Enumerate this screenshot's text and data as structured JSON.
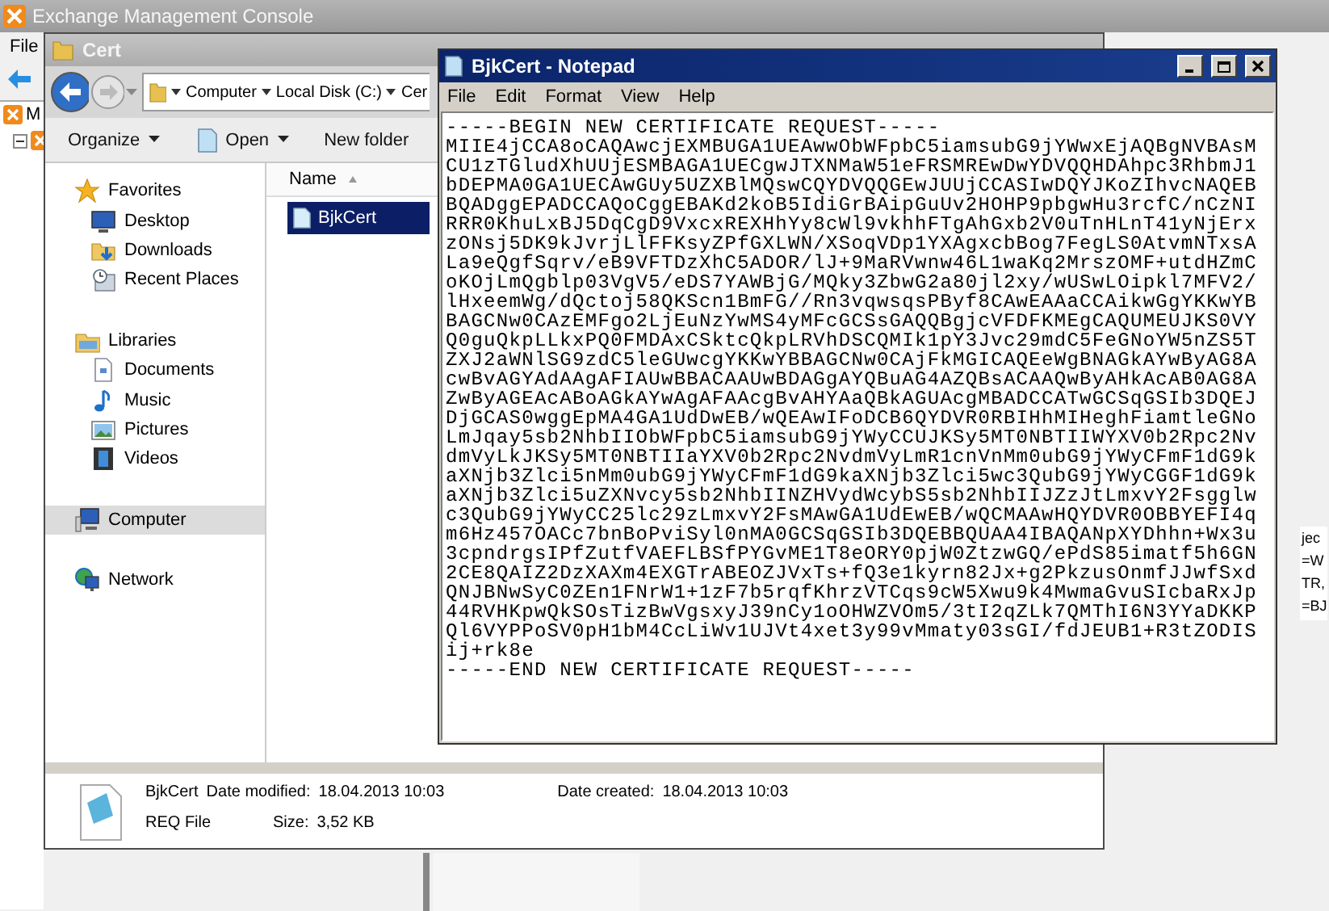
{
  "emc": {
    "title": "Exchange Management Console",
    "menu": [
      "File"
    ],
    "tree": [
      {
        "label": "M",
        "expanded": false
      },
      {
        "expanded": true
      }
    ],
    "fragments": [
      "jec",
      "=W",
      "TR,",
      "=BJ"
    ]
  },
  "explorer": {
    "title": "Cert",
    "breadcrumb": [
      "Computer",
      "Local Disk (C:)",
      "Cer"
    ],
    "toolbar": [
      {
        "label": "Organize",
        "kind": "menu"
      },
      {
        "label": "Open",
        "kind": "open"
      },
      {
        "label": "New folder",
        "kind": "plain"
      }
    ],
    "nav": [
      {
        "label": "Favorites",
        "kind": "star",
        "selected": false,
        "children": [
          {
            "label": "Desktop",
            "kind": "desktop",
            "selected": false
          },
          {
            "label": "Downloads",
            "kind": "downloads",
            "selected": false
          },
          {
            "label": "Recent Places",
            "kind": "recent",
            "selected": false
          }
        ]
      },
      {
        "label": "Libraries",
        "kind": "library",
        "selected": false,
        "children": [
          {
            "label": "Documents",
            "kind": "document",
            "selected": false
          },
          {
            "label": "Music",
            "kind": "music",
            "selected": false
          },
          {
            "label": "Pictures",
            "kind": "picture",
            "selected": false
          },
          {
            "label": "Videos",
            "kind": "video",
            "selected": false
          }
        ]
      },
      {
        "label": "Computer",
        "kind": "computer",
        "selected": true
      },
      {
        "label": "Network",
        "kind": "network",
        "selected": false
      }
    ],
    "columns": [
      "Name"
    ],
    "files": [
      {
        "name": "BjkCert",
        "selected": true
      }
    ],
    "details": {
      "name": "BjkCert",
      "type": "REQ File",
      "modified_label": "Date modified:",
      "modified": "18.04.2013 10:03",
      "size_label": "Size:",
      "size": "3,52 KB",
      "created_label": "Date created:",
      "created": "18.04.2013 10:03"
    }
  },
  "notepad": {
    "title": "BjkCert - Notepad",
    "menu": [
      "File",
      "Edit",
      "Format",
      "View",
      "Help"
    ],
    "lines": [
      "-----BEGIN NEW CERTIFICATE REQUEST-----",
      "MIIE4jCCA8oCAQAwcjEXMBUGA1UEAwwObWFpbC5iamsubG9jYWwxEjAQBgNVBAsM",
      "CU1zTGludXhUUjESMBAGA1UECgwJTXNMaW51eFRSMREwDwYDVQQHDAhpc3RhbmJ1",
      "bDEPMA0GA1UECAwGUy5UZXBlMQswCQYDVQQGEwJUUjCCASIwDQYJKoZIhvcNAQEB",
      "BQADggEPADCCAQoCggEBAKd2koB5IdiGrBAipGuUv2HOHP9pbgwHu3rcfC/nCzNI",
      "RRR0KhuLxBJ5DqCgD9VxcxREXHhYy8cWl9vkhhFTgAhGxb2V0uTnHLnT41yNjErx",
      "zONsj5DK9kJvrjLlFFKsyZPfGXLWN/XSoqVDp1YXAgxcbBog7FegLS0AtvmNTxsA",
      "La9eQgfSqrv/eB9VFTDzXhC5ADOR/lJ+9MaRVwnw46L1waKq2MrszOMF+utdHZmC",
      "oKOjLmQgblp03VgV5/eDS7YAWBjG/MQky3ZbwG2a80jl2xy/wUSwLOipkl7MFV2/",
      "lHxeemWg/dQctoj58QKScn1BmFG//Rn3vqwsqsPByf8CAwEAAaCCAikwGgYKKwYB",
      "BAGCNw0CAzEMFgo2LjEuNzYwMS4yMFcGCSsGAQQBgjcVFDFKMEgCAQUMEUJKS0VY",
      "Q0guQkpLLkxPQ0FMDAxCSktcQkpLRVhDSCQMIk1pY3Jvc29mdC5FeGNoYW5nZS5T",
      "ZXJ2aWNlSG9zdC5leGUwcgYKKwYBBAGCNw0CAjFkMGICAQEeWgBNAGkAYwByAG8A",
      "cwBvAGYAdAAgAFIAUwBBACAAUwBDAGgAYQBuAG4AZQBsACAAQwByAHkAcAB0AG8A",
      "ZwByAGEAcABoAGkAYwAgAFAAcgBvAHYAaQBkAGUAcgMBADCCATwGCSqGSIb3DQEJ",
      "DjGCAS0wggEpMA4GA1UdDwEB/wQEAwIFoDCB6QYDVR0RBIHhMIHeghFiamtleGNo",
      "LmJqay5sb2NhbIIObWFpbC5iamsubG9jYWyCCUJKSy5MT0NBTIIWYXV0b2Rpc2Nv",
      "dmVyLkJKSy5MT0NBTIIaYXV0b2Rpc2NvdmVyLmR1cnVnMm0ubG9jYWyCFmF1dG9k",
      "aXNjb3Zlci5nMm0ubG9jYWyCFmF1dG9kaXNjb3Zlci5wc3QubG9jYWyCGGF1dG9k",
      "aXNjb3Zlci5uZXNvcy5sb2NhbIINZHVydWcybS5sb2NhbIIJZzJtLmxvY2Fsgglw",
      "c3QubG9jYWyCC25lc29zLmxvY2FsMAwGA1UdEwEB/wQCMAAwHQYDVR0OBBYEFI4q",
      "m6Hz457OACc7bnBoPviSyl0nMA0GCSqGSIb3DQEBBQUAA4IBAQANpXYDhhn+Wx3u",
      "3cpndrgsIPfZutfVAEFLBSfPYGvME1T8eORY0pjW0ZtzwGQ/ePdS85imatf5h6GN",
      "2CE8QAIZ2DzXAXm4EXGTrABEOZJVxTs+fQ3e1kyrn82Jx+g2PkzusOnmfJJwfSxd",
      "QNJBNwSyC0ZEn1FNrW1+1zF7b5rqfKhrzVTCqs9cW5Xwu9k4MwmaGvuSIcbaRxJp",
      "44RVHKpwQkSOsTizBwVgsxyJ39nCy1oOHWZVOm5/3tI2qZLk7QMThI6N3YYaDKKP",
      "Ql6VYPPoSV0pH1bM4CcLiWv1UJVt4xet3y99vMmaty03sGI/fdJEUB1+R3tZODIS",
      "ij+rk8e",
      "-----END NEW CERTIFICATE REQUEST-----"
    ]
  }
}
